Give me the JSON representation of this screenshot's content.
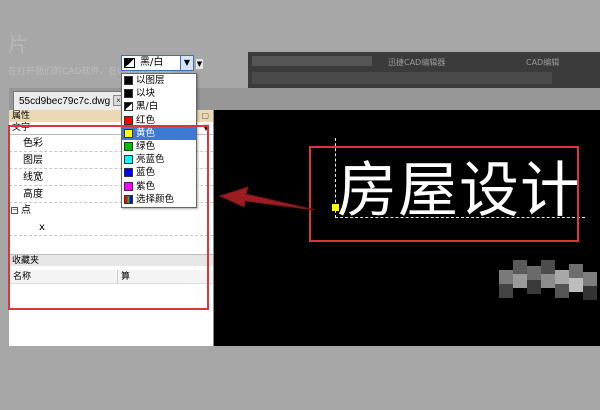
{
  "background": {
    "heading": "片",
    "text": "在打开我们的CAD软件，在CAD软件界面",
    "app_title": "迅捷CAD编辑器",
    "app_right": "CAD编辑"
  },
  "document_tab": {
    "filename": "55cd9bec79c7c.dwg",
    "close": "×"
  },
  "properties": {
    "title": "属性",
    "pin": "▢",
    "object_type": "文字",
    "rows": [
      {
        "label": "色彩",
        "value": "黑/白"
      },
      {
        "label": "图层"
      },
      {
        "label": "线宽"
      },
      {
        "label": "高度"
      }
    ],
    "group": {
      "toggle": "−",
      "label": "点"
    },
    "sub_rows": [
      {
        "label": "x"
      }
    ]
  },
  "favorites": {
    "title": "收藏夹",
    "col_name": "名称",
    "col_other": "算"
  },
  "color_dropdown": {
    "selected": "黑/白",
    "options": [
      {
        "label": "以图层",
        "color": "#000000"
      },
      {
        "label": "以块",
        "color": "#000000"
      },
      {
        "label": "黑/白",
        "color": "bw"
      },
      {
        "label": "红色",
        "color": "#ff0000"
      },
      {
        "label": "黄色",
        "color": "#ffff00",
        "selected": true
      },
      {
        "label": "绿色",
        "color": "#00c000"
      },
      {
        "label": "亮蓝色",
        "color": "#00ffff"
      },
      {
        "label": "蓝色",
        "color": "#0000ff"
      },
      {
        "label": "紫色",
        "color": "#ff00ff"
      },
      {
        "label": "选择颜色",
        "color": "multi"
      }
    ]
  },
  "canvas": {
    "text": "房屋设计"
  },
  "colors": {
    "annotation_red": "#d9363e",
    "panel_title_bg": "#ead9b4",
    "selection_blue": "#3d7ad4"
  }
}
